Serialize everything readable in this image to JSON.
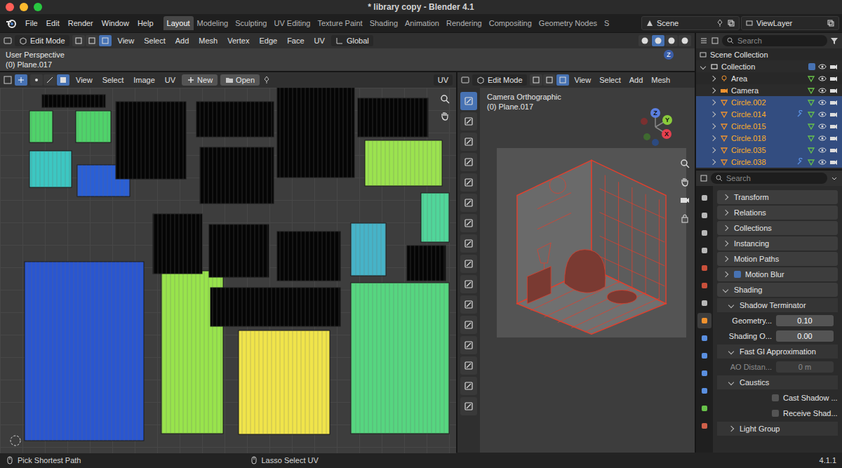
{
  "window": {
    "title": "* library copy - Blender 4.1"
  },
  "menu": [
    "File",
    "Edit",
    "Render",
    "Window",
    "Help"
  ],
  "workspaces": [
    {
      "label": "Layout",
      "selected": true
    },
    {
      "label": "Modeling",
      "selected": false
    },
    {
      "label": "Sculpting",
      "selected": false
    },
    {
      "label": "UV Editing",
      "selected": false
    },
    {
      "label": "Texture Paint",
      "selected": false
    },
    {
      "label": "Shading",
      "selected": false
    },
    {
      "label": "Animation",
      "selected": false
    },
    {
      "label": "Rendering",
      "selected": false
    },
    {
      "label": "Compositing",
      "selected": false
    },
    {
      "label": "Geometry Nodes",
      "selected": false
    },
    {
      "label": "S",
      "selected": false
    }
  ],
  "scene": "Scene",
  "view_layer": "ViewLayer",
  "top_viewport": {
    "mode": "Edit Mode",
    "select_modes": [
      {
        "selected": false
      },
      {
        "selected": false
      },
      {
        "selected": true
      }
    ],
    "menus": [
      "View",
      "Select",
      "Add",
      "Mesh",
      "Vertex",
      "Edge",
      "Face",
      "UV"
    ],
    "orientation": "Global",
    "shading": [
      {
        "selected": false
      },
      {
        "selected": true
      },
      {
        "selected": false
      },
      {
        "selected": false
      }
    ],
    "view": "User Perspective",
    "object": "(0) Plane.017",
    "axis": "Z"
  },
  "uv_editor": {
    "menus": [
      "View",
      "Select",
      "Image",
      "UV"
    ],
    "new": "New",
    "open": "Open",
    "extra": "UV",
    "islands": [
      {
        "color": "#4fd36a"
      },
      {
        "color": "#4fd36a"
      },
      {
        "color": "#3cc7c2"
      },
      {
        "color": "#2a5fd6"
      },
      {
        "color": "#050505"
      },
      {
        "color": "#050505"
      },
      {
        "color": "#050505"
      },
      {
        "color": "#050505"
      },
      {
        "color": "#050505"
      },
      {
        "color": "#9be34f"
      },
      {
        "color": "#50d69a"
      },
      {
        "color": "#050505"
      },
      {
        "color": "#2a56d0"
      },
      {
        "color": "#98e44c"
      },
      {
        "color": "#f0e44a"
      },
      {
        "color": "#56d680"
      },
      {
        "color": "#46b3c8"
      },
      {
        "color": "#050505"
      },
      {
        "color": "#050505"
      },
      {
        "color": "#050505"
      },
      {
        "color": "#050505"
      },
      {
        "color": "#050505"
      }
    ]
  },
  "viewport": {
    "mode": "Edit Mode",
    "select_modes": [
      {
        "selected": false
      },
      {
        "selected": false
      },
      {
        "selected": true
      }
    ],
    "menus": [
      "View",
      "Select",
      "Add",
      "Mesh"
    ],
    "view": "Camera Orthographic",
    "object": "(0) Plane.017",
    "axes": [
      "Z",
      "Y",
      "X"
    ],
    "tools": [
      {
        "selected": true
      },
      {
        "selected": false
      },
      {
        "selected": false
      },
      {
        "selected": false
      },
      {
        "selected": false
      },
      {
        "selected": false
      },
      {
        "selected": false
      },
      {
        "selected": false
      },
      {
        "selected": false
      },
      {
        "selected": false
      },
      {
        "selected": false
      },
      {
        "selected": false
      },
      {
        "selected": false
      },
      {
        "selected": false
      },
      {
        "selected": false
      },
      {
        "selected": false
      }
    ]
  },
  "outliner": {
    "search": "Search",
    "root": "Scene Collection",
    "collection": {
      "name": "Collection",
      "checked": true,
      "expanded": true
    },
    "items": [
      {
        "name": "Area",
        "kind": "light",
        "selected": false,
        "expanded": false,
        "modifier": false
      },
      {
        "name": "Camera",
        "kind": "camera",
        "selected": false,
        "expanded": false,
        "modifier": false
      },
      {
        "name": "Circle.002",
        "kind": "mesh",
        "selected": true,
        "expanded": false,
        "modifier": false
      },
      {
        "name": "Circle.014",
        "kind": "mesh",
        "selected": true,
        "expanded": false,
        "modifier": true
      },
      {
        "name": "Circle.015",
        "kind": "mesh",
        "selected": true,
        "expanded": false,
        "modifier": false
      },
      {
        "name": "Circle.018",
        "kind": "mesh",
        "selected": true,
        "expanded": false,
        "modifier": false
      },
      {
        "name": "Circle.035",
        "kind": "mesh",
        "selected": true,
        "expanded": false,
        "modifier": false
      },
      {
        "name": "Circle.038",
        "kind": "mesh",
        "selected": true,
        "expanded": false,
        "modifier": true
      }
    ]
  },
  "properties": {
    "search": "Search",
    "tabs": [
      {
        "color": "#b8b8b8",
        "selected": false
      },
      {
        "color": "#b8b8b8",
        "selected": false
      },
      {
        "color": "#b8b8b8",
        "selected": false
      },
      {
        "color": "#b8b8b8",
        "selected": false
      },
      {
        "color": "#c9503b",
        "selected": false
      },
      {
        "color": "#c9503b",
        "selected": false
      },
      {
        "color": "#b8b8b8",
        "selected": false
      },
      {
        "color": "#f0922e",
        "selected": true
      },
      {
        "color": "#5a8fe0",
        "selected": false
      },
      {
        "color": "#5a8fe0",
        "selected": false
      },
      {
        "color": "#5a8fe0",
        "selected": false
      },
      {
        "color": "#5a8fe0",
        "selected": false
      },
      {
        "color": "#68c24a",
        "selected": false
      },
      {
        "color": "#d0604a",
        "selected": false
      }
    ],
    "rows": [
      {
        "kind": "panel",
        "label": "Transform",
        "expanded": false
      },
      {
        "kind": "panel",
        "label": "Relations",
        "expanded": false
      },
      {
        "kind": "panel",
        "label": "Collections",
        "expanded": false
      },
      {
        "kind": "panel",
        "label": "Instancing",
        "expanded": false
      },
      {
        "kind": "panel",
        "label": "Motion Paths",
        "expanded": false
      },
      {
        "kind": "panel-check",
        "label": "Motion Blur",
        "expanded": false,
        "checked": true
      },
      {
        "kind": "panel",
        "label": "Shading",
        "expanded": true
      },
      {
        "kind": "subpanel",
        "label": "Shadow Terminator",
        "expanded": true
      },
      {
        "kind": "field",
        "label": "Geometry...",
        "value": "0.10",
        "disabled": false
      },
      {
        "kind": "field",
        "label": "Shading O...",
        "value": "0.00",
        "disabled": false
      },
      {
        "kind": "subpanel",
        "label": "Fast GI Approximation",
        "expanded": true
      },
      {
        "kind": "field",
        "label": "AO Distan...",
        "value": "0 m",
        "disabled": true
      },
      {
        "kind": "subpanel",
        "label": "Caustics",
        "expanded": true
      },
      {
        "kind": "checkbox",
        "label": "Cast Shadow ...",
        "checked": false
      },
      {
        "kind": "checkbox",
        "label": "Receive Shad...",
        "checked": false
      },
      {
        "kind": "subpanel",
        "label": "Light Group",
        "expanded": false
      }
    ]
  },
  "status_bar": {
    "left": "Pick Shortest Path",
    "middle": "Lasso Select UV",
    "version": "4.1.1"
  }
}
